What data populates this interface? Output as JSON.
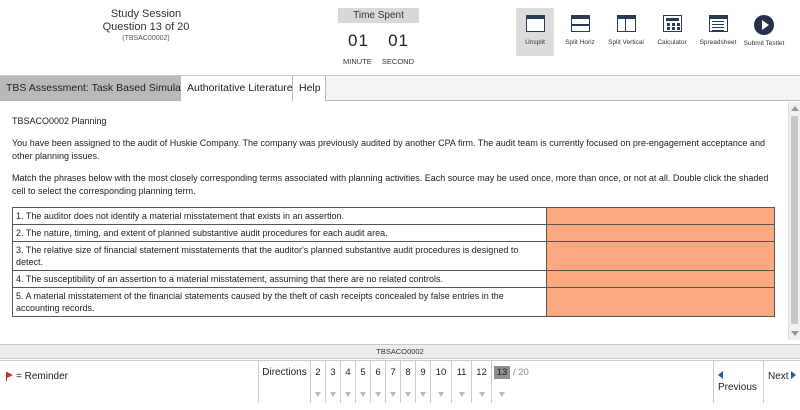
{
  "session": {
    "title": "Study Session",
    "question": "Question 13 of 20",
    "code": "(TBSAC00002)"
  },
  "timer": {
    "label": "Time Spent",
    "minutes": "01",
    "seconds": "01",
    "minute_label": "MINUTE",
    "second_label": "SECOND"
  },
  "tools": [
    {
      "label": "Unsplit",
      "icon": "unsplit-icon",
      "selected": true
    },
    {
      "label": "Split Horiz",
      "icon": "split-horizontal-icon"
    },
    {
      "label": "Split Vertical",
      "icon": "split-vertical-icon"
    },
    {
      "label": "Calculator",
      "icon": "calculator-icon"
    },
    {
      "label": "Spreadsheet",
      "icon": "spreadsheet-icon"
    },
    {
      "label": "Submit Testlet",
      "icon": "submit-arrow-icon"
    }
  ],
  "tabs": [
    {
      "label": "TBS Assessment: Task Based Simulations",
      "active": true
    },
    {
      "label": "Authoritative Literature"
    },
    {
      "label": "Help"
    }
  ],
  "content": {
    "title": "TBSACO0002 Planning",
    "para1": "You have been assigned to the audit of Huskie Company. The company was previously audited by another CPA firm. The audit team is currently focused on pre-engagement acceptance and other planning issues.",
    "para2": "Match the phrases below with the most closely corresponding terms associated with planning activities. Each source may be used once, more than once, or not at all. Double click the shaded cell to select the corresponding planning term.",
    "rows": [
      "1. The auditor does not identify a material misstatement that exists in an assertion.",
      "2. The nature, timing, and extent of planned substantive audit procedures for each audit area.",
      "3. The relative size of financial statement misstatements that the auditor's planned substantive audit procedures is designed to detect.",
      "4. The susceptibility of an assertion to a material misstatement, assuming that there are no related controls.",
      "5. A material misstatement of the financial statements caused by the theft of cash receipts concealed by false entries in the accounting records."
    ],
    "answer_color": "#fca982"
  },
  "id_bar": "TBSACO0002",
  "footer": {
    "reminder": "= Reminder",
    "directions": "Directions",
    "pages": [
      "2",
      "3",
      "4",
      "5",
      "6",
      "7",
      "8",
      "9",
      "10",
      "11",
      "12",
      "13"
    ],
    "current_page": "13",
    "total": "/ 20",
    "previous": "Previous",
    "next": "Next"
  }
}
